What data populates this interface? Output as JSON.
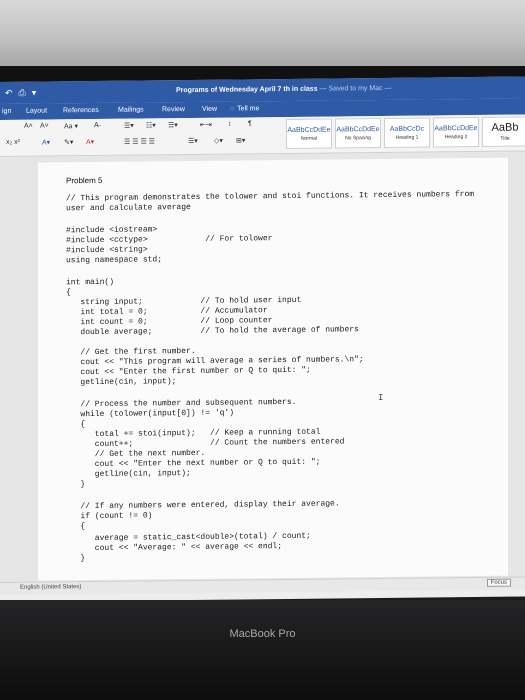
{
  "window": {
    "title": "Programs of Wednesday April 7 th in class",
    "saved_status": "— Saved to my Mac —",
    "quick_access": [
      "↶",
      "⎙",
      "▾"
    ]
  },
  "tabs": [
    "ign",
    "Layout",
    "References",
    "Mailings",
    "Review",
    "View",
    "Tell me"
  ],
  "ribbon": {
    "font_controls": [
      "A˄",
      "A˅",
      "Aa ▾",
      "A̶"
    ],
    "style_gallery": [
      {
        "sample": "AaBbCcDdEe",
        "name": "Normal"
      },
      {
        "sample": "AaBbCcDdEe",
        "name": "No Spacing"
      },
      {
        "sample": "AaBbCcDc",
        "name": "Heading 1"
      },
      {
        "sample": "AaBbCcDdEe",
        "name": "Heading 2"
      },
      {
        "sample": "AaBb",
        "name": "Title"
      }
    ]
  },
  "document": {
    "heading": "Problem 5",
    "lines": [
      "// This program demonstrates the tolower and stoi functions. It receives numbers from",
      "user and calculate average",
      "",
      "#include <iostream>",
      "#include <cctype>            // For tolower",
      "#include <string>",
      "using namespace std;",
      "",
      "int main()",
      "{",
      "   string input;            // To hold user input",
      "   int total = 0;           // Accumulator",
      "   int count = 0;           // Loop counter",
      "   double average;          // To hold the average of numbers",
      "",
      "   // Get the first number.",
      "   cout << \"This program will average a series of numbers.\\n\";",
      "   cout << \"Enter the first number or Q to quit: \";",
      "   getline(cin, input);",
      "",
      "   // Process the number and subsequent numbers.",
      "   while (tolower(input[0]) != 'q')",
      "   {",
      "      total += stoi(input);   // Keep a running total",
      "      count++;                // Count the numbers entered",
      "      // Get the next number.",
      "      cout << \"Enter the next number or Q to quit: \";",
      "      getline(cin, input);",
      "   }",
      "",
      "   // If any numbers were entered, display their average.",
      "   if (count != 0)",
      "   {",
      "      average = static_cast<double>(total) / count;",
      "      cout << \"Average: \" << average << endl;",
      "   }"
    ]
  },
  "status": {
    "language": "English (United States)",
    "focus": "Focus"
  },
  "device": {
    "label": "MacBook Pro"
  }
}
